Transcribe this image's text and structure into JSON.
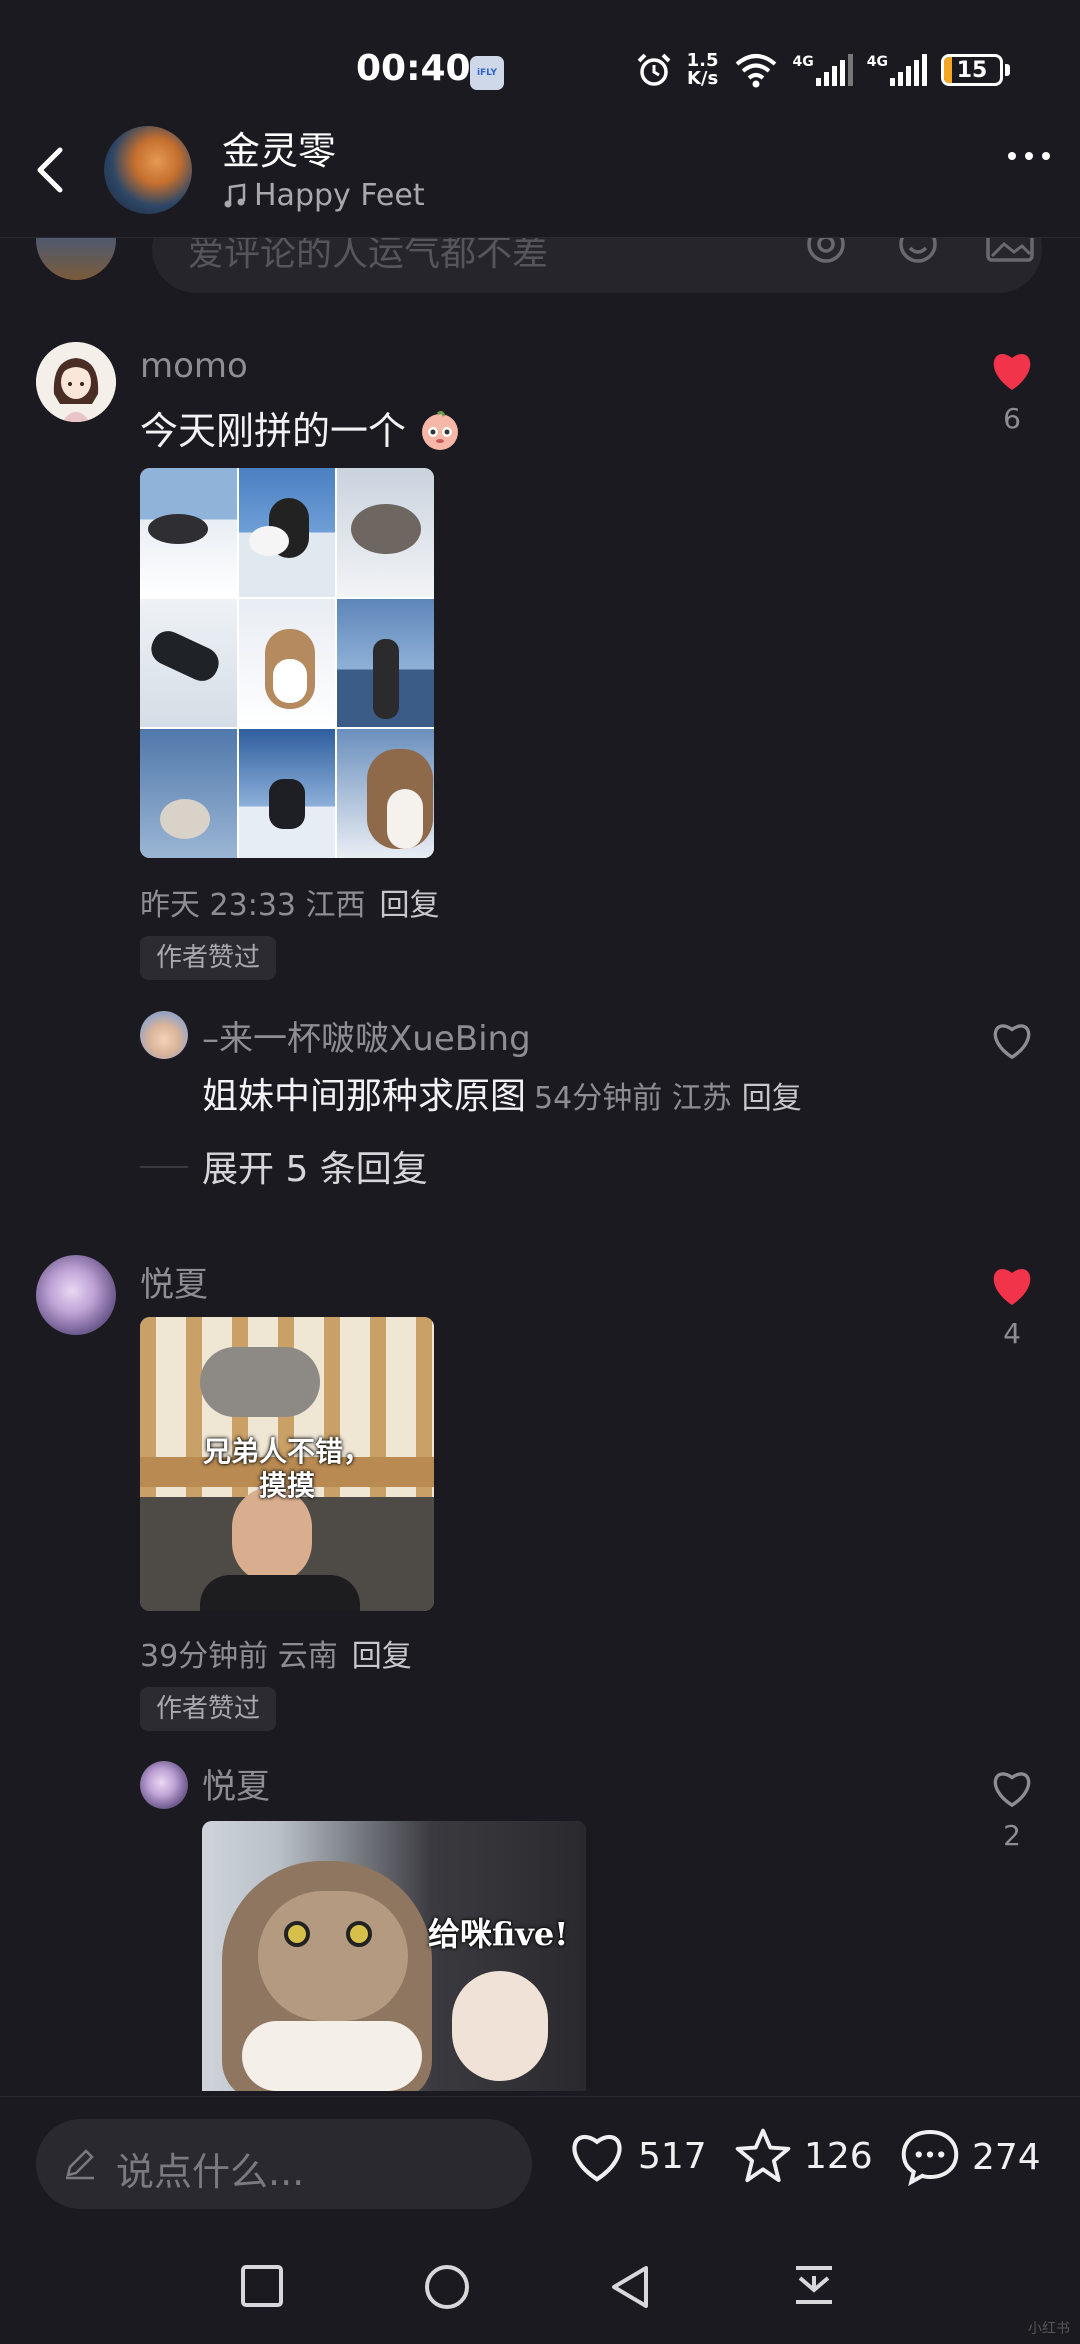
{
  "status": {
    "time": "00:40",
    "app_badge": "iFLY",
    "net_speed_top": "1.5",
    "net_speed_bottom": "K/s",
    "sim1": "4G",
    "sim2": "4G",
    "battery": "15",
    "battery_level": 0.15
  },
  "header": {
    "author": "金灵零",
    "music": "Happy Feet"
  },
  "top_input": {
    "placeholder": "爱评论的人运气都不差"
  },
  "comments": [
    {
      "user": "momo",
      "text": "今天刚拼的一个",
      "time": "昨天 23:33 江西",
      "reply": "回复",
      "badge": "作者赞过",
      "likes": "6",
      "liked": true
    },
    {
      "user": "悦夏",
      "image_caption_1": "兄弟人不错，",
      "image_caption_2": "摸摸",
      "time": "39分钟前 云南",
      "reply": "回复",
      "badge": "作者赞过",
      "likes": "4",
      "liked": true
    }
  ],
  "replies": [
    {
      "user": "–来一杯啵啵XueBing",
      "text": "姐妹中间那种求原图",
      "time": "54分钟前 江苏",
      "reply": "回复",
      "likes": "",
      "liked": false
    },
    {
      "user": "悦夏",
      "image_caption": "给咪five!",
      "likes": "2",
      "liked": false
    }
  ],
  "expand": "展开 5 条回复",
  "bottom": {
    "placeholder": "说点什么...",
    "likes": "517",
    "favorites": "126",
    "comments": "274"
  },
  "colors": {
    "background": "#1b1a20",
    "liked_heart": "#f2344a",
    "battery": "#f5a623"
  },
  "watermark": "小红书"
}
